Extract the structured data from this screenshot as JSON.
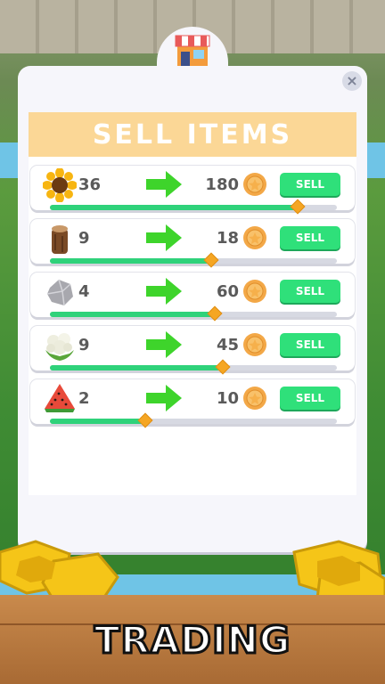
{
  "title": "SELL ITEMS",
  "footer_title": "TRADING",
  "close_label": "×",
  "items": [
    {
      "name": "sunflower",
      "qty": "36",
      "price": "180",
      "sell_label": "SELL",
      "progress": 0.86
    },
    {
      "name": "log",
      "qty": "9",
      "price": "18",
      "sell_label": "SELL",
      "progress": 0.56
    },
    {
      "name": "stone",
      "qty": "4",
      "price": "60",
      "sell_label": "SELL",
      "progress": 0.57
    },
    {
      "name": "cauliflower",
      "qty": "9",
      "price": "45",
      "sell_label": "SELL",
      "progress": 0.6
    },
    {
      "name": "watermelon",
      "qty": "2",
      "price": "10",
      "sell_label": "SELL",
      "progress": 0.33
    }
  ],
  "colors": {
    "sell_button": "#2fe07a",
    "header_bg": "#fbd796",
    "progress_fill": "#2fd27a",
    "handle": "#f5a623"
  }
}
